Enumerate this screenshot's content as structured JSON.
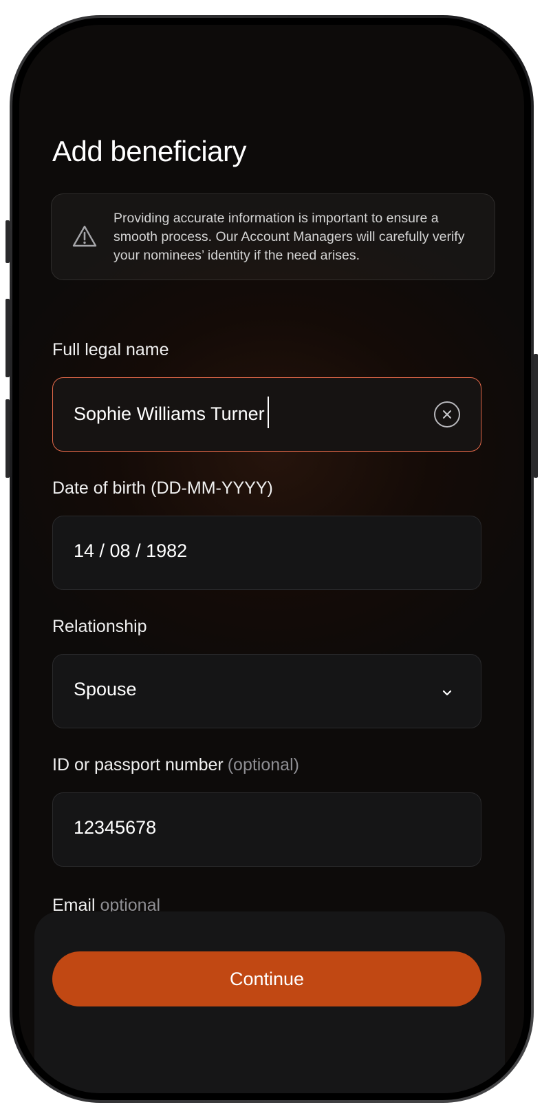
{
  "page": {
    "title": "Add beneficiary"
  },
  "notice": {
    "icon": "warning-triangle-icon",
    "text": "Providing accurate information is important to ensure a smooth process. Our Account Managers will carefully verify your nominees’ identity if the need arises."
  },
  "fields": {
    "full_name": {
      "label": "Full legal name",
      "value": "Sophie Williams Turner",
      "clear_icon": "clear-circle-icon"
    },
    "dob": {
      "label": "Date of birth (DD-MM-YYYY)",
      "value": "14 / 08 / 1982"
    },
    "relationship": {
      "label": "Relationship",
      "value": "Spouse",
      "icon": "chevron-down-icon"
    },
    "id_number": {
      "label": "ID or passport number",
      "optional": "(optional)",
      "value": "12345678"
    },
    "email": {
      "label": "Email",
      "optional": "optional"
    }
  },
  "actions": {
    "continue_label": "Continue"
  },
  "colors": {
    "accent": "#c14813",
    "active_border": "#e4694a",
    "background": "#0d0b0a"
  }
}
